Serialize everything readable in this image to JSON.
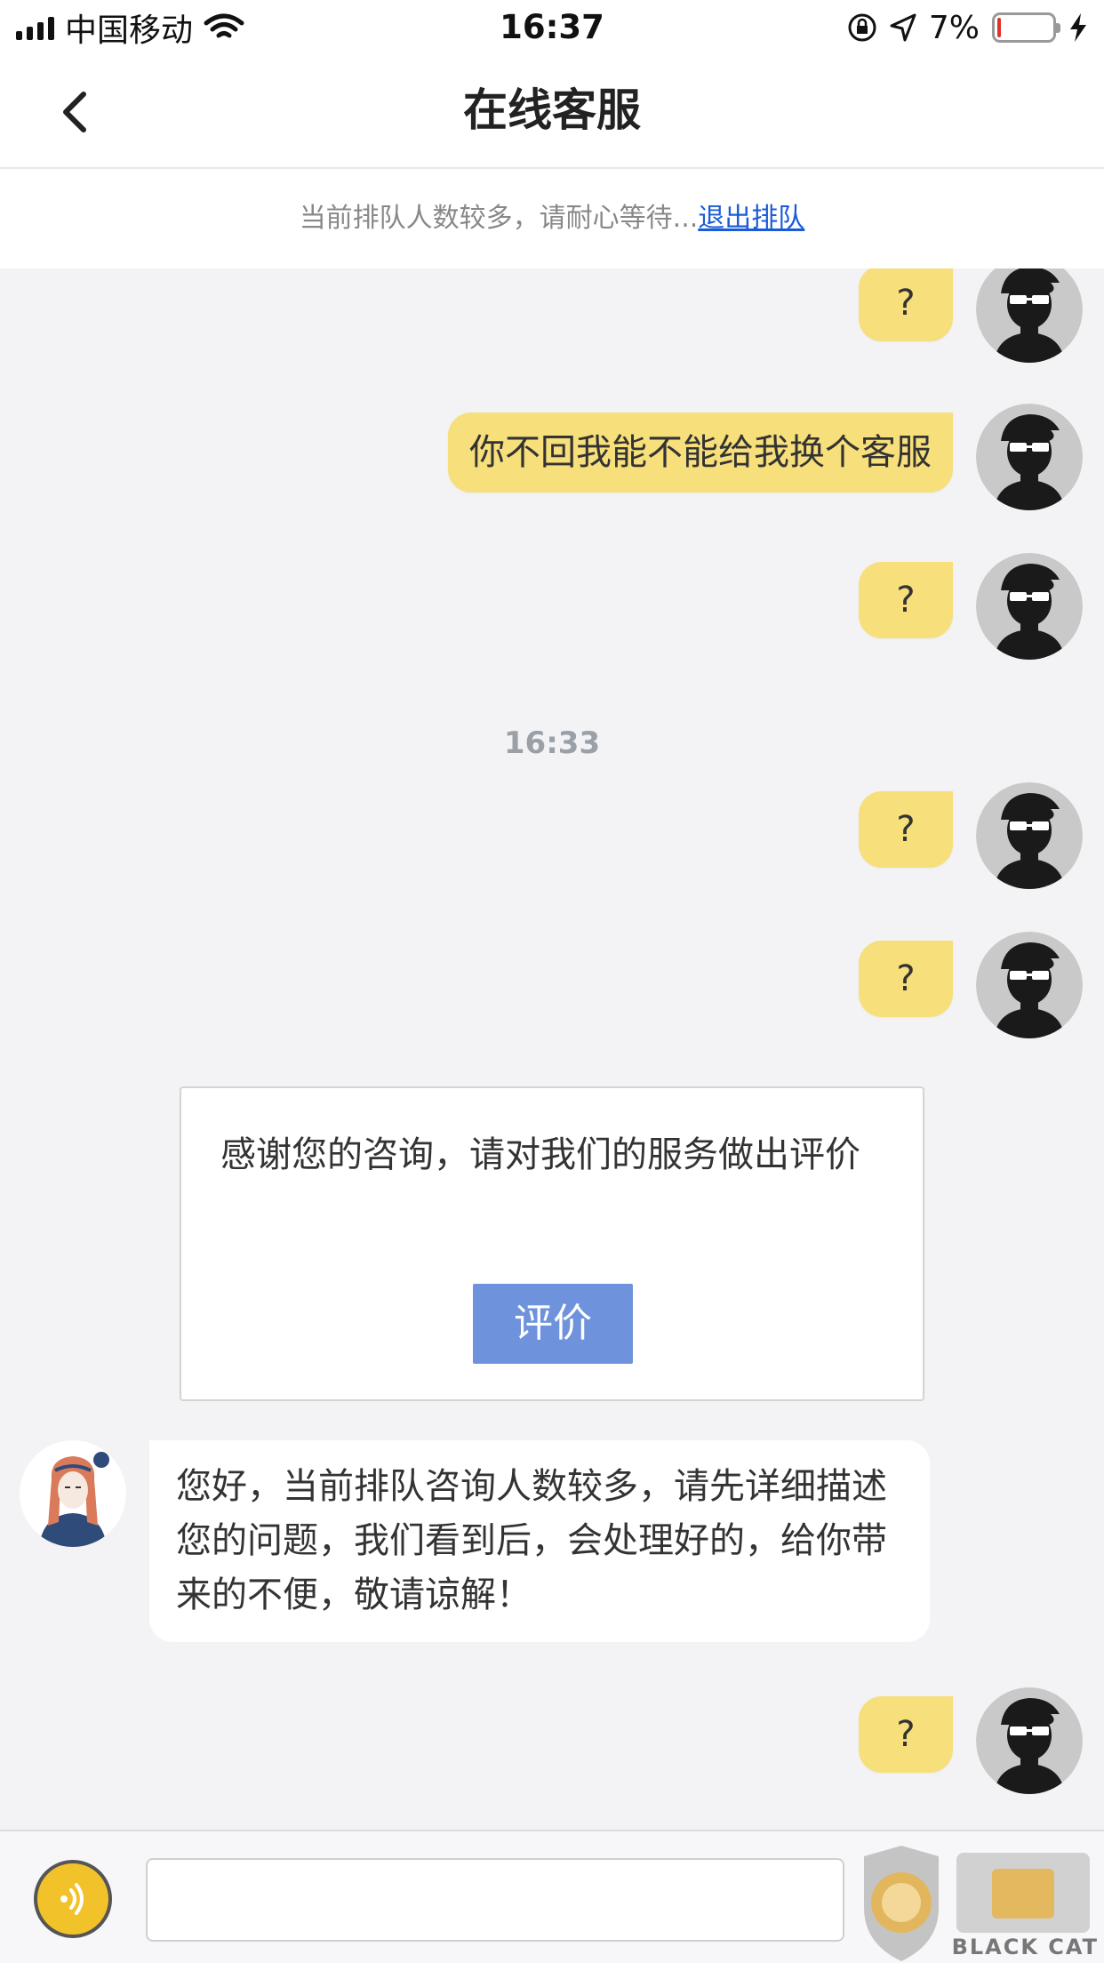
{
  "status_bar": {
    "carrier": "中国移动",
    "time": "16:37",
    "battery_percent": "7%",
    "battery_level": 0.07
  },
  "nav": {
    "title": "在线客服",
    "back_icon": "chevron-left-icon"
  },
  "queue": {
    "notice": "当前排队人数较多，请耐心等待...",
    "exit_link": "退出排队"
  },
  "chat": {
    "messages_top": [
      {
        "text": "?"
      },
      {
        "text": "你不回我能不能给我换个客服"
      },
      {
        "text": "?"
      }
    ],
    "timestamp": "16:33",
    "messages_mid": [
      {
        "text": "?"
      },
      {
        "text": "?"
      }
    ],
    "evaluation": {
      "text": "感谢您的咨询，请对我们的服务做出评价",
      "button": "评价"
    },
    "agent_message": "您好，当前排队咨询人数较多，请先详细描述您的问题，我们看到后，会处理好的，给你带来的不便，敬请谅解！",
    "last_message": "?"
  },
  "input": {
    "value": "",
    "voice_icon": "voice-icon"
  },
  "watermark": {
    "text": "BLACK CAT"
  },
  "colors": {
    "user_bubble": "#f7df7b",
    "eval_button": "#6e93dc",
    "link": "#1a5bd8",
    "background": "#f3f3f5"
  }
}
